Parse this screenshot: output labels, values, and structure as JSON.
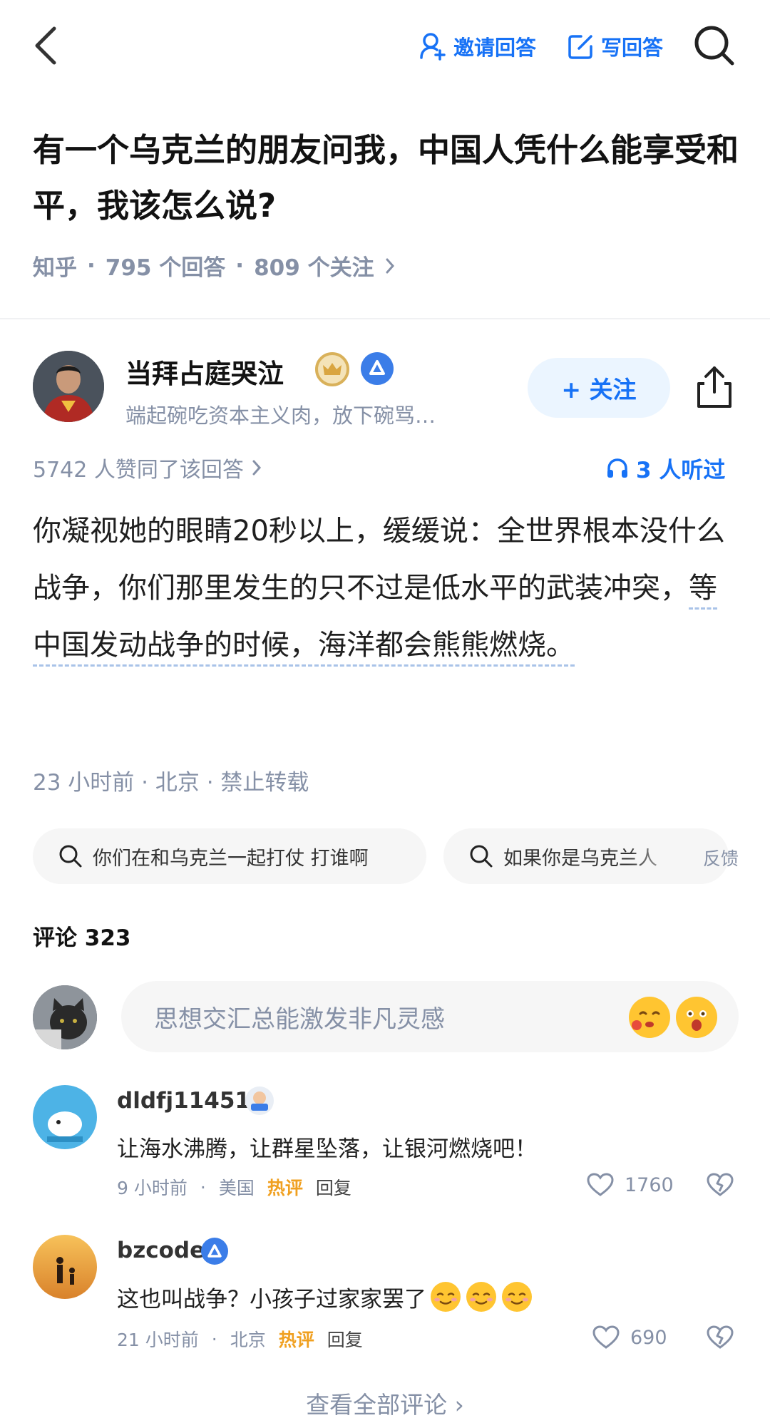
{
  "topbar": {
    "invite_label": "邀请回答",
    "write_label": "写回答"
  },
  "question": {
    "title": "有一个乌克兰的朋友问我，中国人凭什么能享受和平，我该怎么说?",
    "source": "知乎",
    "answers": "795 个回答",
    "follows": "809 个关注"
  },
  "author": {
    "name": "当拜占庭哭泣",
    "bio": "端起碗吃资本主义肉，放下碗骂…",
    "follow_label": "+ 关注"
  },
  "answer": {
    "agree": "5742 人赞同了该回答",
    "listened": "3 人听过",
    "body_part1": "你凝视她的眼睛20秒以上，缓缓说：全世界根本没什么战争，你们那里发生的只不过是低水平的武装冲突，",
    "body_part2": "等中国发动战争的时候，海洋都会熊熊燃烧。",
    "meta": "23 小时前 · 北京 · 禁止转载"
  },
  "suggestions": {
    "items": [
      "你们在和乌克兰一起打仗 打谁啊",
      "如果你是乌克兰人"
    ],
    "feedback": "反馈"
  },
  "comments": {
    "header": "评论 323",
    "input_placeholder": "思想交汇总能激发非凡灵感",
    "list": [
      {
        "user": "dldfj114514",
        "text": "让海水沸腾，让群星坠落，让银河燃烧吧！",
        "time": "9 小时前",
        "location": "美国",
        "tag": "热评",
        "reply": "回复",
        "likes": "1760"
      },
      {
        "user": "bzcode",
        "text": "这也叫战争？小孩子过家家罢了",
        "time": "21 小时前",
        "location": "北京",
        "tag": "热评",
        "reply": "回复",
        "likes": "690"
      }
    ],
    "view_all": "查看全部评论 ›"
  }
}
